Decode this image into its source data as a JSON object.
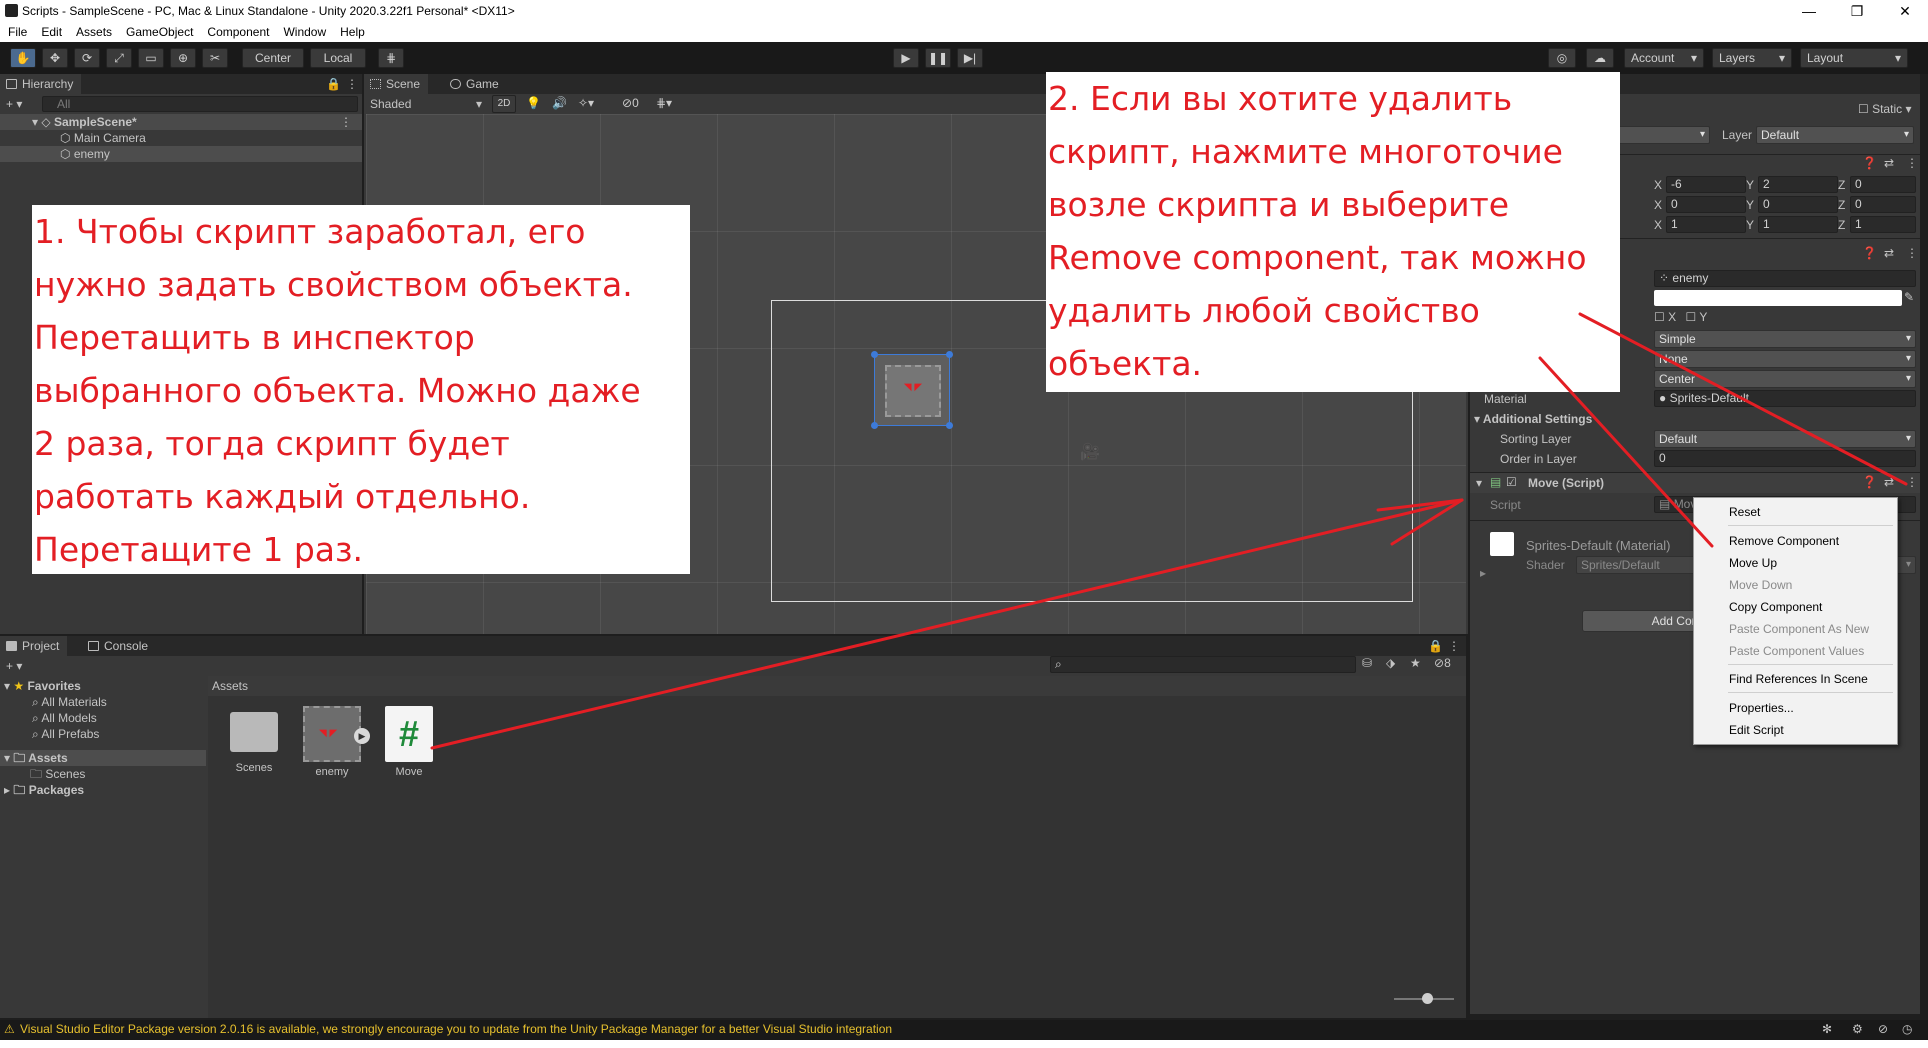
{
  "window": {
    "title": "Scripts - SampleScene - PC, Mac & Linux Standalone - Unity 2020.3.22f1 Personal* <DX11>",
    "minimize": "—",
    "maximize": "❐",
    "close": "✕"
  },
  "menu": [
    "File",
    "Edit",
    "Assets",
    "GameObject",
    "Component",
    "Window",
    "Help"
  ],
  "toolbar": {
    "pivot": "Center",
    "space": "Local",
    "account": "Account",
    "layers": "Layers",
    "layout": "Layout"
  },
  "hierarchy": {
    "tab": "Hierarchy",
    "search_placeholder": "All",
    "scene": "SampleScene*",
    "items": [
      "Main Camera",
      "enemy"
    ]
  },
  "scene": {
    "tab_scene": "Scene",
    "tab_game": "Game",
    "shading": "Shaded",
    "mode2d": "2D",
    "gizmo_count": "0"
  },
  "notes": {
    "left": [
      "1. Чтобы скрипт заработал, его",
      "нужно задать свойством объекта.",
      "Перетащить в инспектор",
      "выбранного объекта. Можно даже",
      "2 раза, тогда скрипт будет",
      "работать каждый отдельно.",
      "Перетащите 1 раз."
    ],
    "right": [
      "2. Если вы хотите удалить",
      "скрипт, нажмите многоточие",
      "возле скрипта и выберите",
      "Remove component, так можно",
      "удалить любой свойство",
      "объекта."
    ]
  },
  "inspector": {
    "static": "Static",
    "layer_label": "Layer",
    "layer_value": "Default",
    "position": {
      "x": "-6",
      "y": "2",
      "z": "0"
    },
    "rotation": {
      "x": "0",
      "y": "0",
      "z": "0"
    },
    "scale": {
      "x": "1",
      "y": "1",
      "z": "1"
    },
    "sprite": "enemy",
    "flip_x": "X",
    "flip_y": "Y",
    "draw_mode": "Simple",
    "mask": "None",
    "sort_point": "Center",
    "material_label": "Material",
    "material_value": "Sprites-Default",
    "additional_settings": "Additional Settings",
    "sorting_layer_label": "Sorting Layer",
    "sorting_layer_value": "Default",
    "order_label": "Order in Layer",
    "order_value": "0",
    "script_component": "Move (Script)",
    "script_label": "Script",
    "script_value": "Move",
    "material_asset": "Sprites-Default (Material)",
    "shader_label": "Shader",
    "shader_value": "Sprites/Default",
    "add_component": "Add Component"
  },
  "context_menu": {
    "items": [
      {
        "label": "Reset",
        "enabled": true
      },
      {
        "label": "Remove Component",
        "enabled": true
      },
      {
        "label": "Move Up",
        "enabled": true
      },
      {
        "label": "Move Down",
        "enabled": false
      },
      {
        "label": "Copy Component",
        "enabled": true
      },
      {
        "label": "Paste Component As New",
        "enabled": false
      },
      {
        "label": "Paste Component Values",
        "enabled": false
      },
      {
        "label": "Find References In Scene",
        "enabled": true
      },
      {
        "label": "Properties...",
        "enabled": true
      },
      {
        "label": "Edit Script",
        "enabled": true
      }
    ]
  },
  "project": {
    "tab_project": "Project",
    "tab_console": "Console",
    "favorites": "Favorites",
    "fav_items": [
      "All Materials",
      "All Models",
      "All Prefabs"
    ],
    "assets": "Assets",
    "scenes": "Scenes",
    "packages": "Packages",
    "breadcrumb": "Assets",
    "hidden_count": "8",
    "files": [
      "Scenes",
      "enemy",
      "Move"
    ]
  },
  "status": {
    "message": "Visual Studio Editor Package version 2.0.16 is available, we strongly encourage you to update from the Unity Package Manager for a better Visual Studio integration"
  }
}
